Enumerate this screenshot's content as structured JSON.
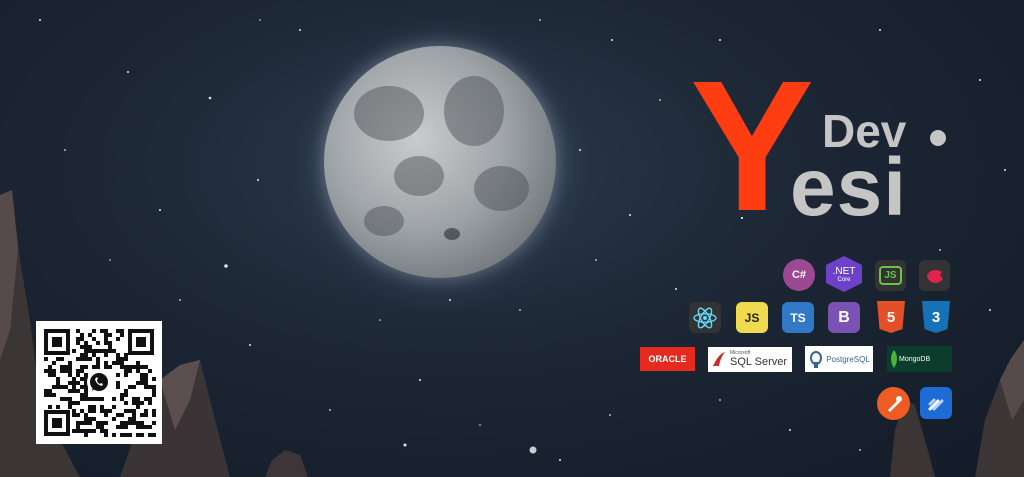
{
  "logo": {
    "initial": "Y",
    "dev": "Dev",
    "name": "esi"
  },
  "colors": {
    "accent": "#ff3d12",
    "logo_gray": "#c5c5c5",
    "sky": "#1c2634"
  },
  "tech_icons": [
    {
      "label": "C#",
      "icon": "csharp-icon"
    },
    {
      "label": ".NET",
      "sublabel": "Core",
      "icon": "dotnet-core-icon"
    },
    {
      "label": "JS",
      "icon": "nodejs-icon"
    },
    {
      "label": "",
      "icon": "nestjs-icon"
    },
    {
      "label": "",
      "icon": "react-icon"
    },
    {
      "label": "JS",
      "icon": "javascript-icon"
    },
    {
      "label": "TS",
      "icon": "typescript-icon"
    },
    {
      "label": "B",
      "icon": "bootstrap-icon"
    },
    {
      "label": "5",
      "icon": "html5-icon"
    },
    {
      "label": "3",
      "icon": "css3-icon"
    },
    {
      "label": "",
      "icon": "postman-icon"
    },
    {
      "label": "",
      "icon": "jira-icon"
    }
  ],
  "databases": [
    {
      "label": "ORACLE",
      "icon": "oracle-logo"
    },
    {
      "label": "SQL Server",
      "sublabel": "Microsoft",
      "icon": "sql-server-logo"
    },
    {
      "label": "PostgreSQL",
      "icon": "postgresql-logo"
    },
    {
      "label": "MongoDB",
      "icon": "mongodb-logo"
    }
  ],
  "qr": {
    "icon": "whatsapp-icon"
  }
}
